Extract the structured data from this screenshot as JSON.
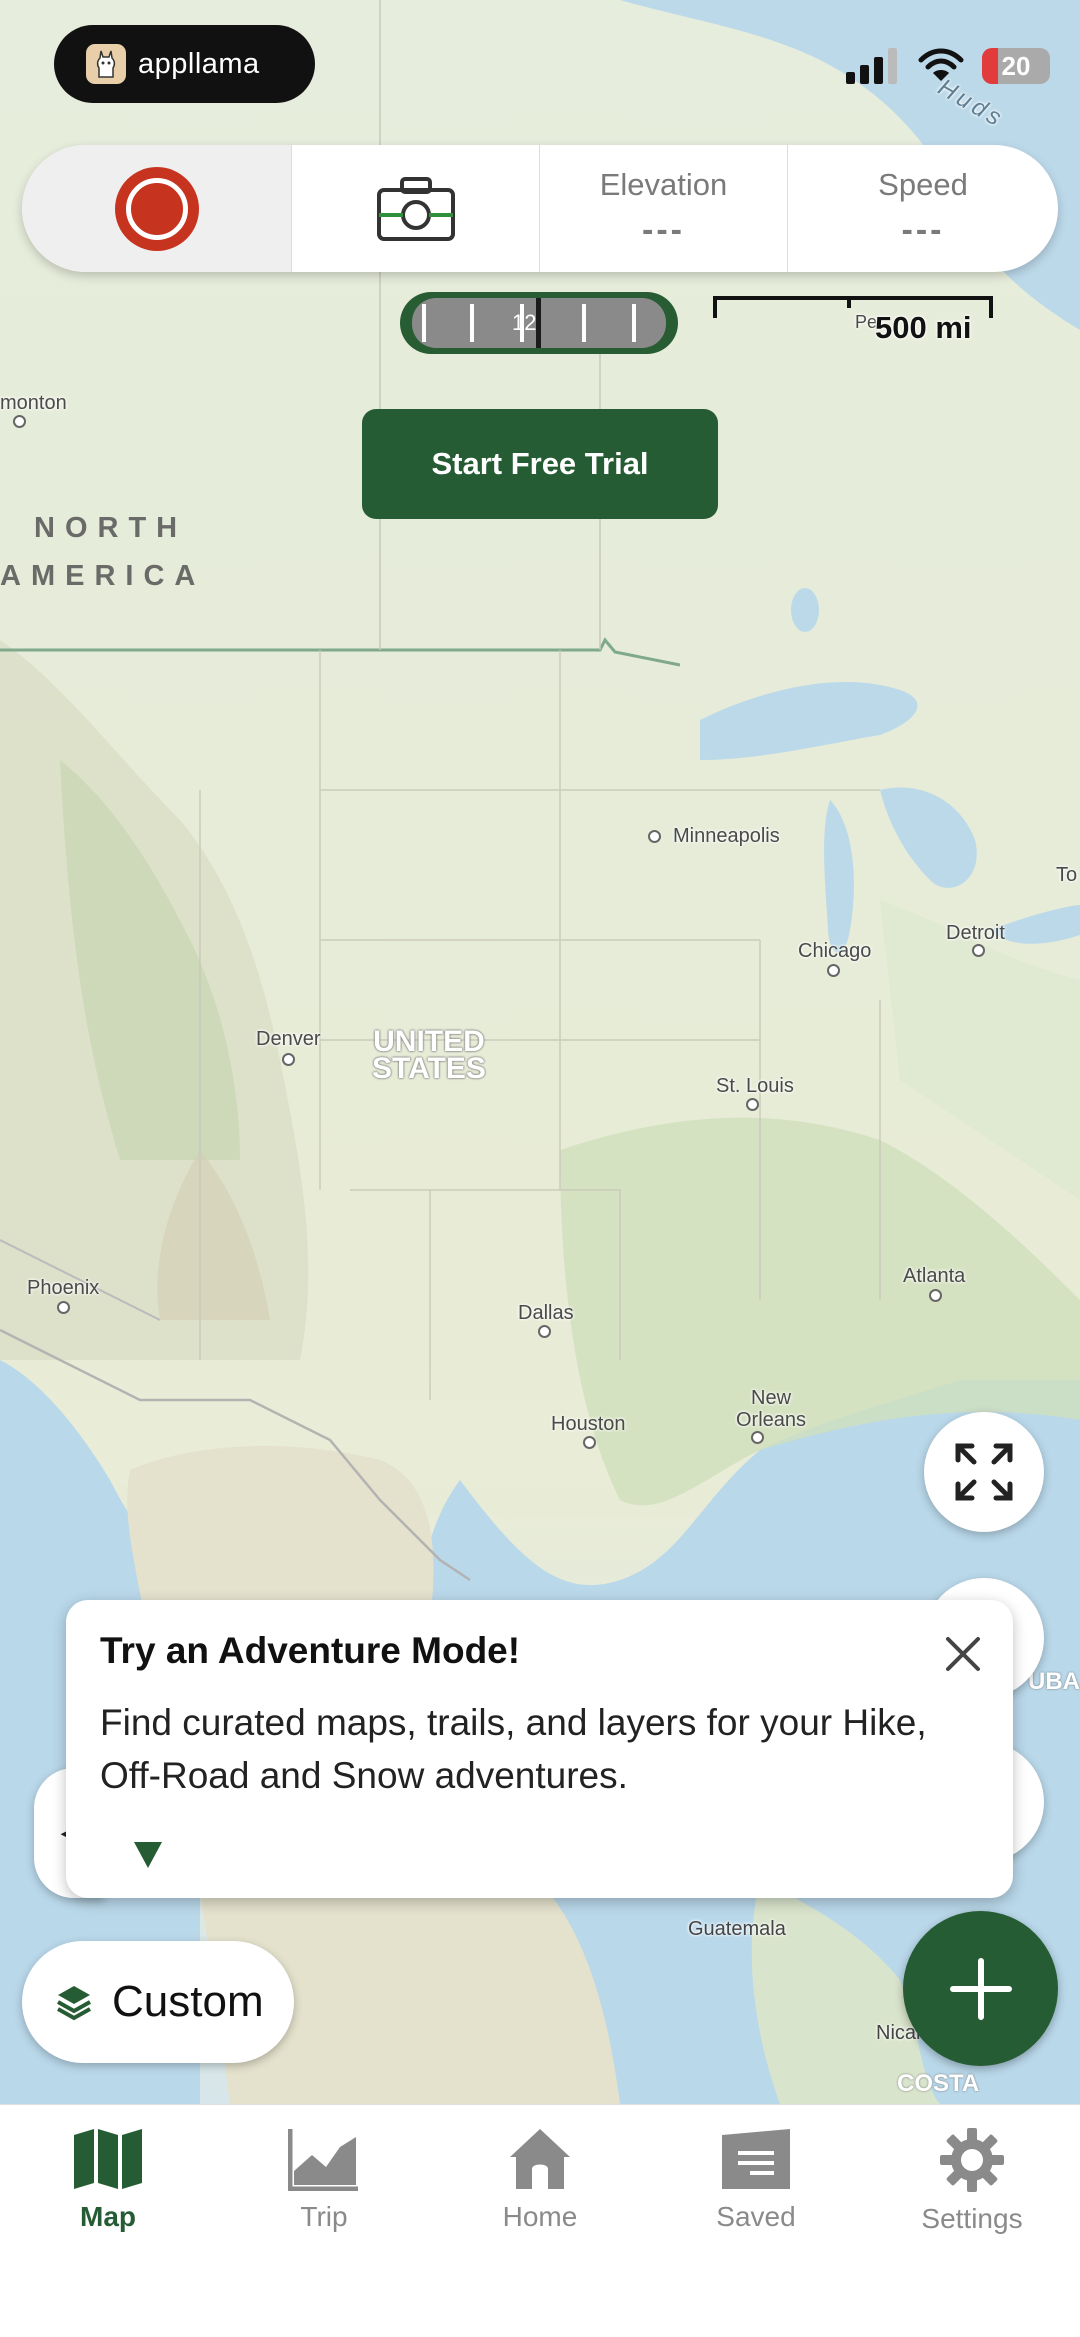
{
  "status_bar": {
    "brand": "appllama",
    "battery": "20"
  },
  "toolbar": {
    "record_label": "",
    "elevation_label": "Elevation",
    "elevation_value": "---",
    "speed_label": "Speed",
    "speed_value": "---"
  },
  "zoom": {
    "level": "12"
  },
  "scale": {
    "label": "500 mi"
  },
  "trial_button": "Start Free Trial",
  "map": {
    "region_label_1": "NORTH",
    "region_label_2": "AMERICA",
    "country_line1": "UNITED",
    "country_line2": "STATES",
    "cities": {
      "edmonton": "monton",
      "minneapolis": "Minneapolis",
      "chicago": "Chicago",
      "detroit": "Detroit",
      "toronto": "To",
      "denver": "Denver",
      "st_louis": "St. Louis",
      "phoenix": "Phoenix",
      "dallas": "Dallas",
      "atlanta": "Atlanta",
      "houston": "Houston",
      "new_orleans_1": "New",
      "new_orleans_2": "Orleans",
      "guatemala": "Guatemala",
      "nicaragua": "Nicarag",
      "costa": "COSTA",
      "cuba": "UBA",
      "pe": "Pe",
      "hudson": "Huds"
    }
  },
  "tooltip": {
    "title": "Try an Adventure Mode!",
    "body": "Find curated maps, trails, and layers for your Hike, Off-Road and Snow adventures."
  },
  "custom_button": "Custom",
  "tabs": [
    {
      "label": "Map",
      "icon": "map-icon"
    },
    {
      "label": "Trip",
      "icon": "chart-icon"
    },
    {
      "label": "Home",
      "icon": "home-icon"
    },
    {
      "label": "Saved",
      "icon": "saved-icon"
    },
    {
      "label": "Settings",
      "icon": "gear-icon"
    }
  ],
  "colors": {
    "accent": "#265c33",
    "record": "#c6341f",
    "battery_low": "#e23b3b"
  }
}
